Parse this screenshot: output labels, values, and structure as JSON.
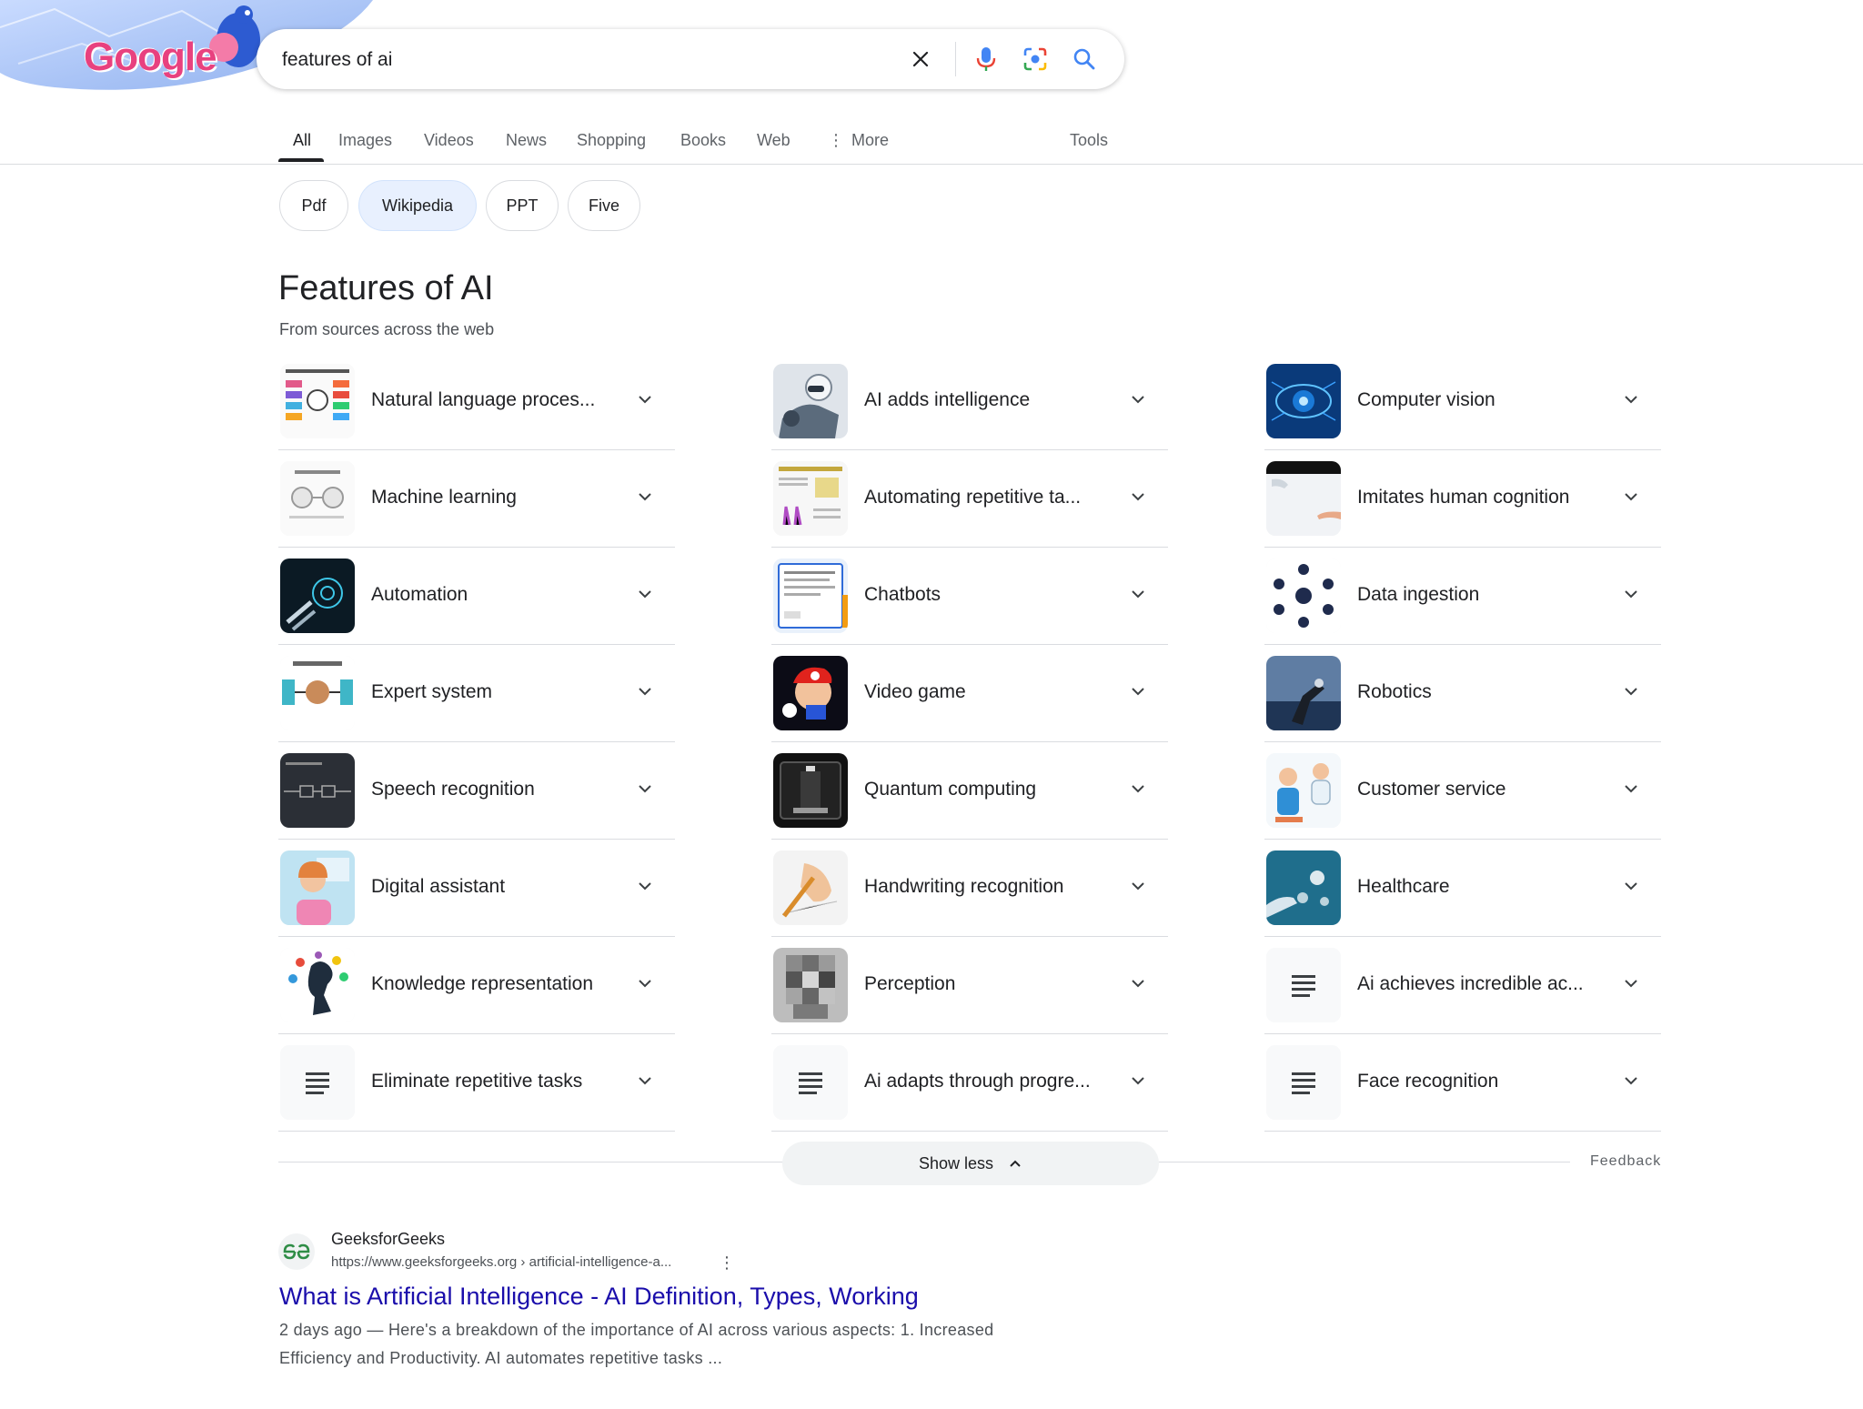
{
  "header": {
    "logo_text": "Google",
    "search": {
      "value": "features of ai",
      "placeholder": ""
    }
  },
  "tabs": [
    {
      "label": "All",
      "active": true
    },
    {
      "label": "Images"
    },
    {
      "label": "Videos"
    },
    {
      "label": "News"
    },
    {
      "label": "Shopping"
    },
    {
      "label": "Books"
    },
    {
      "label": "Web"
    },
    {
      "label": "More"
    },
    {
      "label": "Tools"
    }
  ],
  "chips": [
    {
      "label": "Pdf",
      "selected": false
    },
    {
      "label": "Wikipedia",
      "selected": true
    },
    {
      "label": "PPT",
      "selected": false
    },
    {
      "label": "Five",
      "selected": false
    }
  ],
  "panel": {
    "title": "Features of AI",
    "subtitle": "From sources across the web",
    "columns": [
      [
        {
          "label": "Natural language proces...",
          "thumb": "nlp-diagram"
        },
        {
          "label": "Machine learning",
          "thumb": "ml-diagram"
        },
        {
          "label": "Automation",
          "thumb": "robot-hand-dark"
        },
        {
          "label": "Expert system",
          "thumb": "expert-system-diagram"
        },
        {
          "label": "Speech recognition",
          "thumb": "speech-diagram-dark"
        },
        {
          "label": "Digital assistant",
          "thumb": "headset-woman"
        },
        {
          "label": "Knowledge representation",
          "thumb": "head-icons"
        },
        {
          "label": "Eliminate repetitive tasks",
          "thumb": "text-lines-icon"
        }
      ],
      [
        {
          "label": "AI adds intelligence",
          "thumb": "humanoid-robot"
        },
        {
          "label": "Automating repetitive ta...",
          "thumb": "automation-infographic"
        },
        {
          "label": "Chatbots",
          "thumb": "chat-document"
        },
        {
          "label": "Video game",
          "thumb": "mario"
        },
        {
          "label": "Quantum computing",
          "thumb": "quantum-chamber"
        },
        {
          "label": "Handwriting recognition",
          "thumb": "hand-writing"
        },
        {
          "label": "Perception",
          "thumb": "pixelated-face"
        },
        {
          "label": "Ai adapts through progre...",
          "thumb": "text-lines-icon"
        }
      ],
      [
        {
          "label": "Computer vision",
          "thumb": "blue-eye"
        },
        {
          "label": "Imitates human cognition",
          "thumb": "hands-touch"
        },
        {
          "label": "Data ingestion",
          "thumb": "icon-circle"
        },
        {
          "label": "Robotics",
          "thumb": "robot-arm"
        },
        {
          "label": "Customer service",
          "thumb": "agent-illustration"
        },
        {
          "label": "Healthcare",
          "thumb": "medical-hand"
        },
        {
          "label": "Ai achieves incredible ac...",
          "thumb": "text-lines-icon"
        },
        {
          "label": "Face recognition",
          "thumb": "text-lines-icon"
        }
      ]
    ],
    "show_less": "Show less",
    "feedback": "Feedback"
  },
  "result": {
    "site_name": "GeeksforGeeks",
    "url": "https://www.geeksforgeeks.org › artificial-intelligence-a...",
    "title": "What is Artificial Intelligence - AI Definition, Types, Working",
    "snippet_line1": "2 days ago — Here's a breakdown of the importance of AI across various aspects: 1. Increased",
    "snippet_line2": "Efficiency and Productivity. AI automates repetitive tasks ..."
  },
  "colors": {
    "link": "#1a0dab",
    "chip_selected": "#e8f0fe",
    "divider": "#dadce0",
    "doodle_bg": "#a9c4f5"
  }
}
